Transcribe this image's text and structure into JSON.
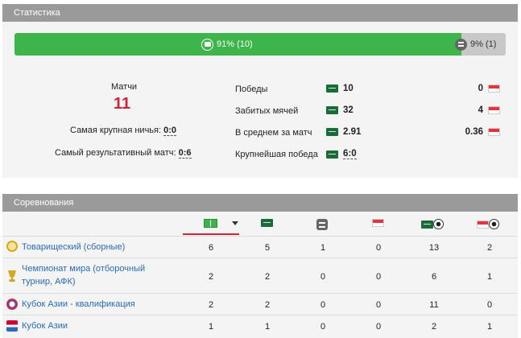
{
  "stats": {
    "header": "Статистика",
    "bar": {
      "win_label": "91% (10)",
      "draw_label": "9% (1)",
      "win_fraction": 0.91
    },
    "matches_label": "Матчи",
    "matches_value": "11",
    "biggest_draw_label": "Самая крупная ничья:",
    "biggest_draw_value": "0:0",
    "most_productive_label": "Самый результативный матч:",
    "most_productive_value": "0:6",
    "rows": [
      {
        "label": "Победы",
        "home": "10",
        "away": "0"
      },
      {
        "label": "Забитых мячей",
        "home": "32",
        "away": "4"
      },
      {
        "label": "В среднем за матч",
        "home": "2.91",
        "away": "0.36"
      },
      {
        "label": "Крупнейшая победа",
        "home": "6:0"
      }
    ]
  },
  "competitions": {
    "header": "Соревнования",
    "columns": [
      "matches-icon",
      "home-wins-flag",
      "draws-icon",
      "away-wins-flag",
      "home-goals-flag-ball",
      "away-goals-flag-ball"
    ],
    "rows": [
      {
        "name": "Товарищеский (сборные)",
        "icon": "peace-icon",
        "values": [
          "6",
          "5",
          "1",
          "0",
          "13",
          "2"
        ]
      },
      {
        "name": "Чемпионат мира (отборочный турнир, АФК)",
        "icon": "trophy-icon",
        "values": [
          "2",
          "2",
          "0",
          "0",
          "6",
          "1"
        ]
      },
      {
        "name": "Кубок Азии - квалификация",
        "icon": "afc-emblem-icon",
        "values": [
          "2",
          "2",
          "0",
          "0",
          "11",
          "0"
        ]
      },
      {
        "name": "Кубок Азии",
        "icon": "asian-cup-icon",
        "values": [
          "1",
          "1",
          "0",
          "0",
          "2",
          "1"
        ]
      }
    ]
  },
  "colors": {
    "win": "#3db54a",
    "accent": "#c8283a",
    "link": "#2a6cb4",
    "header": "#9a9a9a"
  }
}
